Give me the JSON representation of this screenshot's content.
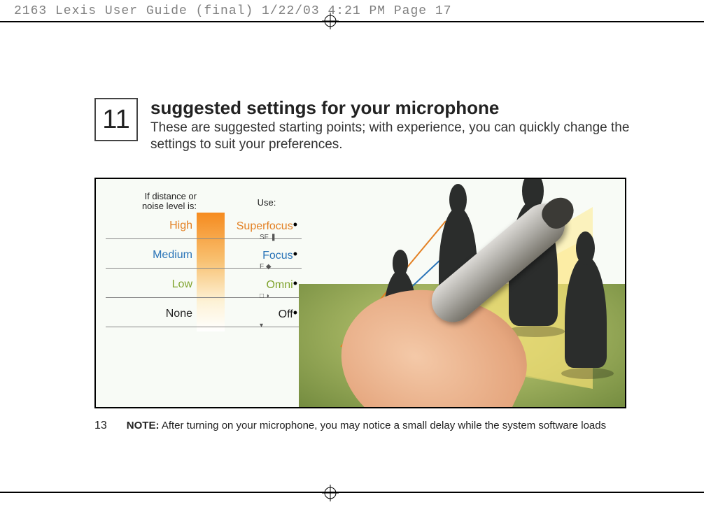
{
  "header_line": "2163 Lexis User Guide (final)  1/22/03  4:21 PM  Page 17",
  "section_number": "11",
  "title": "suggested settings for your microphone",
  "subtitle": "These are suggested starting points; with experience, you can quickly change the settings to suit your preferences.",
  "table": {
    "col1_head": "If distance or\nnoise level is:",
    "col2_head": "Use:",
    "rows": [
      {
        "level": "High",
        "mode": "Superfocus",
        "sub": "SF"
      },
      {
        "level": "Medium",
        "mode": "Focus",
        "sub": "F"
      },
      {
        "level": "Low",
        "mode": "Omni",
        "sub": "□"
      },
      {
        "level": "None",
        "mode": "Off",
        "sub": ""
      }
    ]
  },
  "page_ref": "13",
  "note_label": "NOTE:",
  "note_text": "After turning on your microphone, you may notice a small delay while the system software loads"
}
